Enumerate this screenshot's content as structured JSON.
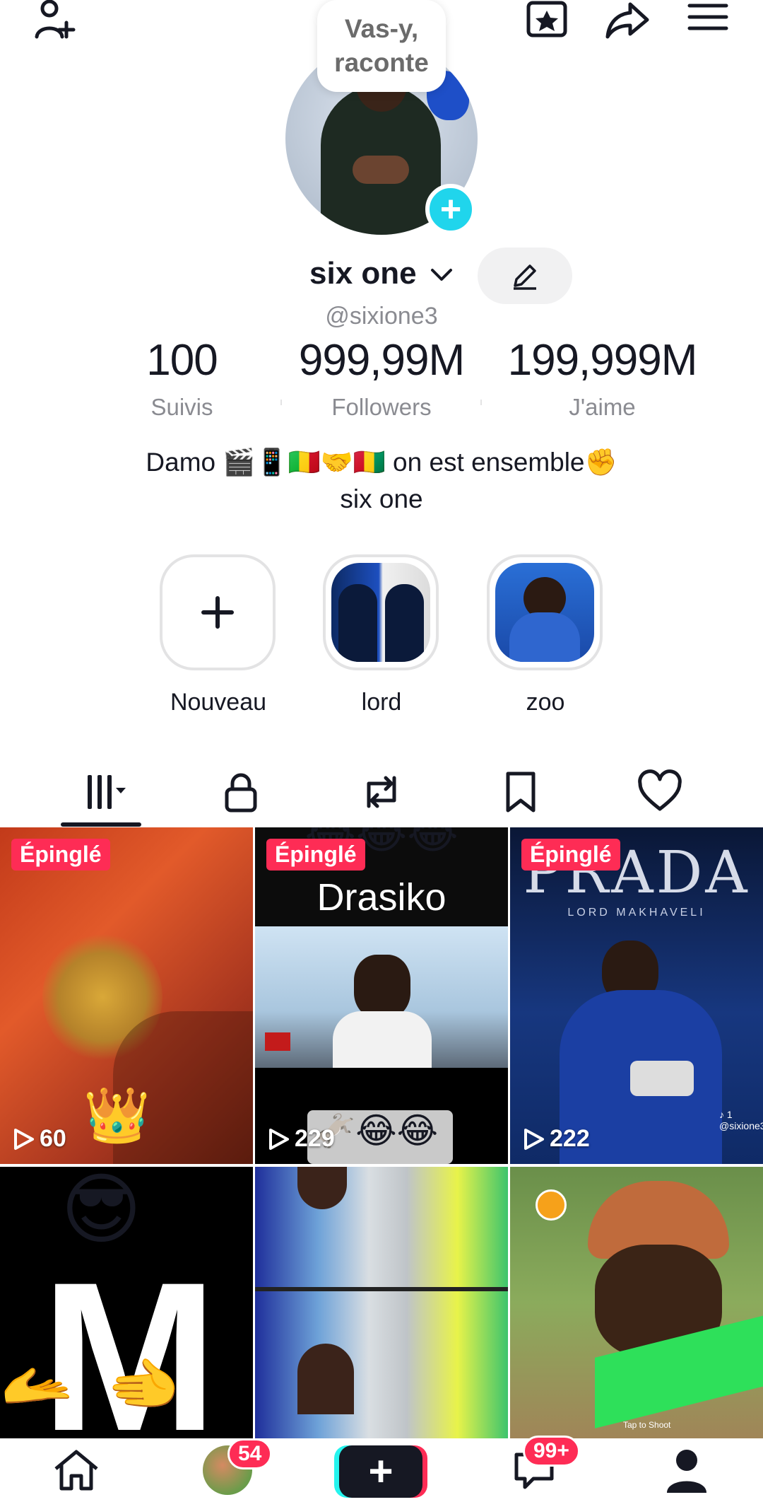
{
  "top_bar": {
    "add_friend_icon": "person-plus-icon",
    "favorites_icon": "star-box-icon",
    "share_icon": "share-arrow-icon",
    "menu_icon": "hamburger-menu-icon"
  },
  "profile": {
    "story_bubble": "Vas-y,\nraconte",
    "display_name": "six one",
    "handle": "@sixione3",
    "stats": [
      {
        "value": "100",
        "label": "Suivis"
      },
      {
        "value": "999,99M",
        "label": "Followers"
      },
      {
        "value": "199,999M",
        "label": "J'aime"
      }
    ],
    "bio_line1": "Damo 🎬📱🇲🇱🤝🇬🇳 on est ensemble✊",
    "bio_line2": "six one"
  },
  "highlights": [
    {
      "label": "Nouveau",
      "type": "new"
    },
    {
      "label": "lord",
      "type": "story"
    },
    {
      "label": "zoo",
      "type": "story"
    }
  ],
  "tabs": [
    "videos-grid-icon",
    "lock-icon",
    "repost-icon",
    "bookmark-icon",
    "heart-icon"
  ],
  "grid": [
    {
      "pinned": "Épinglé",
      "views": "60",
      "overlay": "👑"
    },
    {
      "pinned": "Épinglé",
      "views": "229",
      "title": "Drasiko",
      "emoji_top": "😂😂😂",
      "emoji_bottom": "🫏😂😂"
    },
    {
      "pinned": "Épinglé",
      "views": "222",
      "title": "PRADA",
      "subtitle": "LORD MAKHAVELI",
      "watermark": "♪ 1 @sixione3"
    },
    {
      "overlay": "😎",
      "letter": "M",
      "hands": "🫴  🫲"
    },
    {},
    {
      "caption": "Tap to Shoot"
    }
  ],
  "bottom_nav": {
    "home_icon": "home-icon",
    "friends_badge": "54",
    "create_label": "+",
    "inbox_badge": "99+",
    "profile_icon": "profile-icon"
  },
  "colors": {
    "accent_red": "#fe2c55",
    "accent_cyan": "#20d5ec",
    "text_primary": "#161823",
    "text_secondary": "#8a8b91"
  }
}
